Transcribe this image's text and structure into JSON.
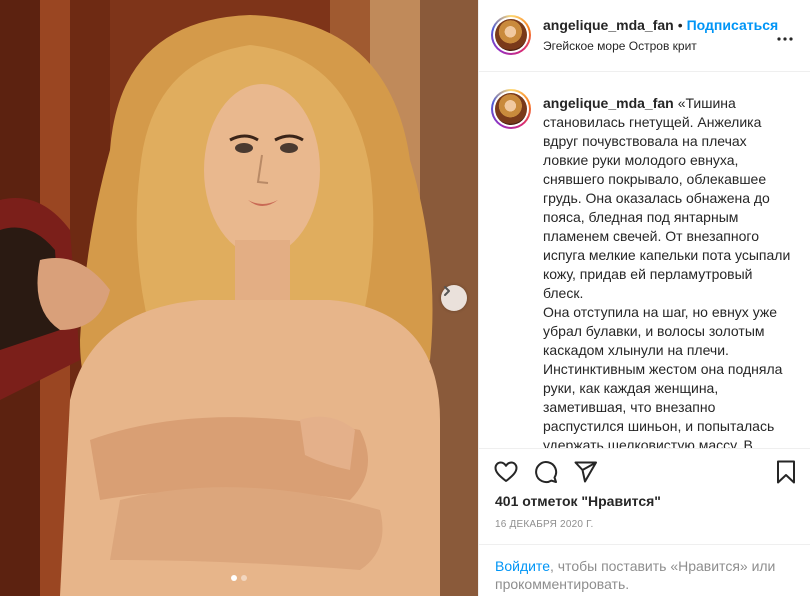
{
  "post": {
    "username": "angelique_mda_fan",
    "separator": "•",
    "follow_label": "Подписаться",
    "location": "Эгейское море Остров крит",
    "caption": "«Тишина становилась гнетущей. Анжелика вдруг почувствовала на плечах ловкие руки молодого евнуха, снявшего покрывало, облекавшее грудь. Она оказалась обнажена до пояса, бледная под янтарным пламенем свечей. От внезапного испуга мелкие капельки пота усыпали кожу, придав ей перламутровый блеск.\nОна отступила на шаг, но евнух уже убрал булавки, и волосы золотым каскадом хлынули на плечи. Инстинктивным жестом она подняла руки, как каждая женщина, заметившая, что внезапно распустился шиньон, и попыталась удержать шелковистую массу. В",
    "likes": "401 отметок \"Нравится\"",
    "date": "16 ДЕКАБРЯ 2020 Г.",
    "login_link": "Войдите",
    "login_rest": ", чтобы поставить «Нравится» или прокомментировать."
  },
  "carousel": {
    "slide_count": 2,
    "active_index": 0
  },
  "icons": {
    "more": "more-horizontal-icon",
    "next": "chevron-right-icon",
    "like": "heart-icon",
    "comment": "comment-icon",
    "share": "paper-plane-icon",
    "save": "bookmark-icon"
  },
  "colors": {
    "accent": "#0095f6",
    "text": "#262626",
    "muted": "#8e8e8e",
    "border": "#efefef"
  }
}
